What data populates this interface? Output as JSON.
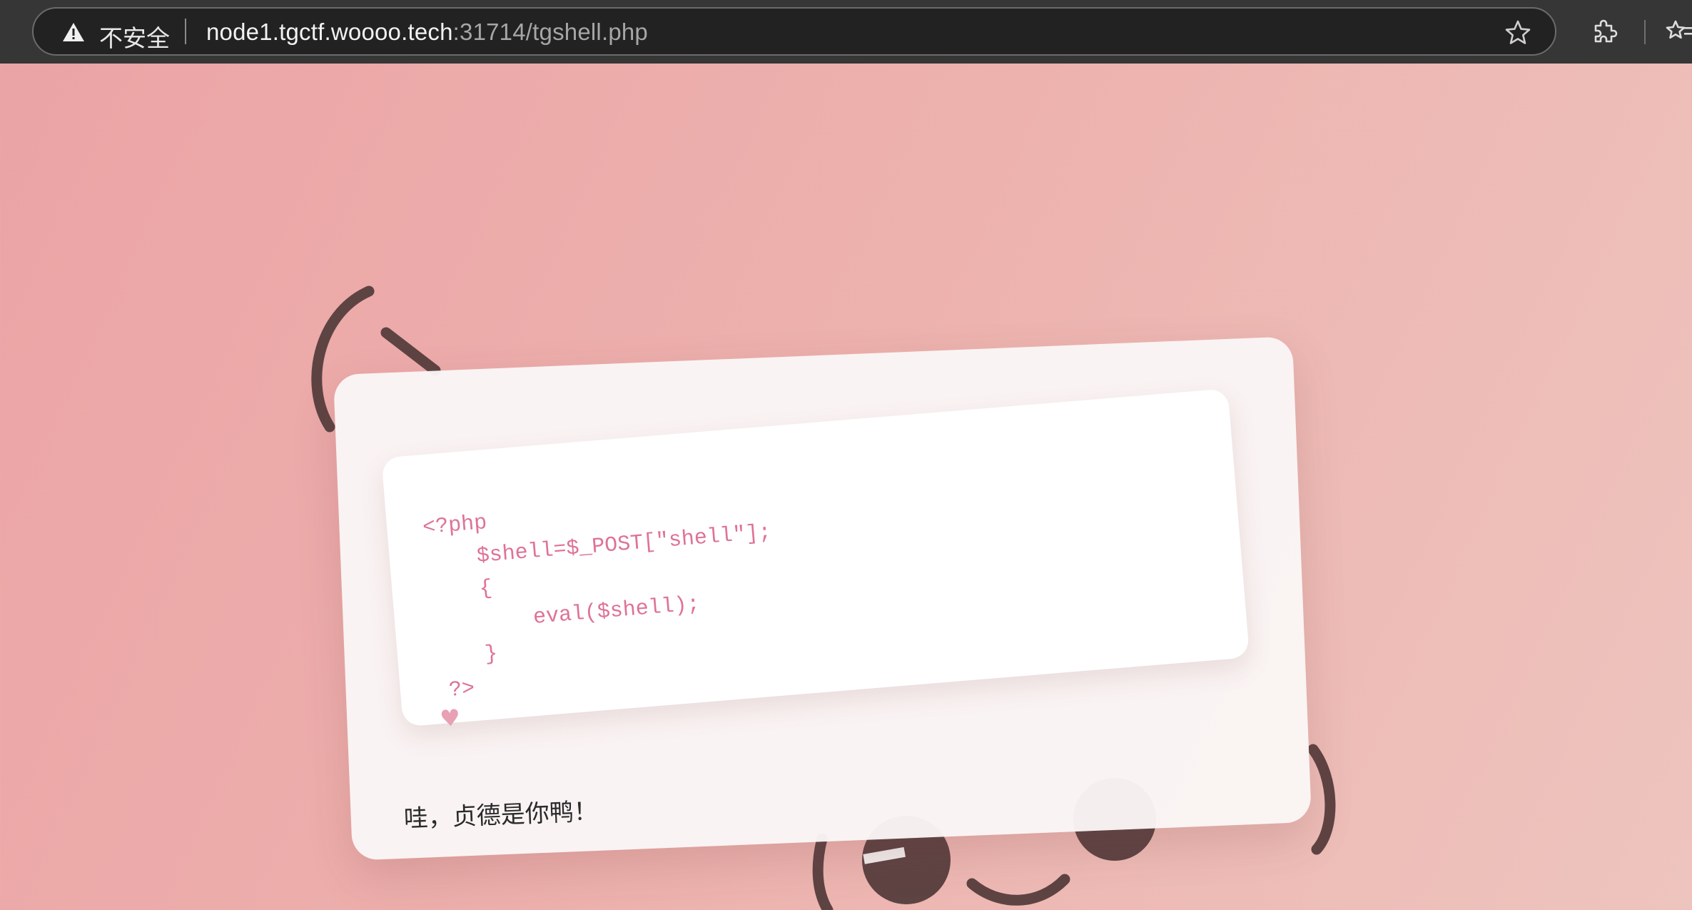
{
  "browser": {
    "security_label": "不安全",
    "url_host": "node1.tgctf.woooo.tech",
    "url_rest": ":31714/tgshell.php",
    "icons": [
      "warning-icon",
      "star-icon",
      "extensions-icon",
      "favorites-icon"
    ]
  },
  "page": {
    "code": "<?php\n    $shell=$_POST[\"shell\"];\n    {\n        eval($shell);\n    }\n ?>",
    "heart": "♥",
    "caption": "哇，贞德是你鸭！",
    "colors": {
      "background_start": "#eba3a5",
      "background_end": "#eec4be",
      "code_text": "#de7396",
      "kaomoji_stroke": "#5e4343"
    }
  }
}
